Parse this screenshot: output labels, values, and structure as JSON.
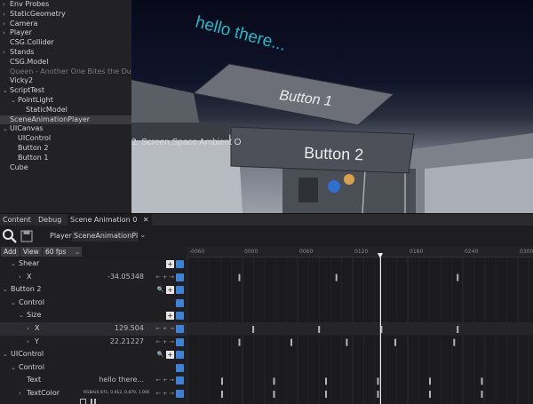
{
  "tree": [
    {
      "label": "Env Probes",
      "chev": "›",
      "indent": 0
    },
    {
      "label": "StaticGeometry",
      "chev": "›",
      "indent": 0
    },
    {
      "label": "Camera",
      "chev": "›",
      "indent": 0
    },
    {
      "label": "Player",
      "chev": "›",
      "indent": 0
    },
    {
      "label": "CSG.Collider",
      "chev": "",
      "indent": 0
    },
    {
      "label": "Stands",
      "chev": "›",
      "indent": 0
    },
    {
      "label": "CSG.Model",
      "chev": "",
      "indent": 0
    },
    {
      "label": "Queen - Another One Bites the Dust",
      "chev": "",
      "indent": 0,
      "dim": true
    },
    {
      "label": "Vicky2",
      "chev": "",
      "indent": 0
    },
    {
      "label": "ScriptTest",
      "chev": "⌄",
      "indent": 0
    },
    {
      "label": "PointLight",
      "chev": "⌄",
      "indent": 1
    },
    {
      "label": "StaticModel",
      "chev": "",
      "indent": 2
    },
    {
      "label": "SceneAnimationPlayer",
      "chev": "",
      "indent": 0,
      "selected": true
    },
    {
      "label": "UICanvas",
      "chev": "⌄",
      "indent": 0
    },
    {
      "label": "UIControl",
      "chev": "",
      "indent": 1
    },
    {
      "label": "Button 2",
      "chev": "",
      "indent": 1
    },
    {
      "label": "Button 1",
      "chev": "",
      "indent": 1
    },
    {
      "label": "Cube",
      "chev": "",
      "indent": 0
    }
  ],
  "viewport": {
    "hello_text": "hello there...",
    "button1_label": "Button 1",
    "button2_label": "Button 2",
    "wall_sign": "2. Screen Space Ambient O"
  },
  "tabs": {
    "content": "Content",
    "debug": "Debug",
    "scene_animation": "Scene Animation 0",
    "close": "✕"
  },
  "toolbar": {
    "player_label": "Player:",
    "player_value": "SceneAnimationPla",
    "add_label": "Add",
    "view_label": "View",
    "fps_value": "60 fps"
  },
  "tracks": [
    {
      "label": "Shear",
      "chev": "⌄",
      "indent": 1,
      "value": "",
      "plus": true
    },
    {
      "label": "X",
      "chev": "›",
      "indent": 2,
      "value": "-34.05348",
      "arrows": true
    },
    {
      "label": "Button 2",
      "chev": "⌄",
      "indent": 0,
      "value": "",
      "plus": true,
      "search": true
    },
    {
      "label": "Control",
      "chev": "⌄",
      "indent": 1,
      "value": "",
      "plus": false
    },
    {
      "label": "Size",
      "chev": "⌄",
      "indent": 2,
      "value": "",
      "plus": true
    },
    {
      "label": "X",
      "chev": "›",
      "indent": 3,
      "value": "129.504",
      "arrows": true,
      "highlight": true
    },
    {
      "label": "Y",
      "chev": "›",
      "indent": 3,
      "value": "22.21227",
      "arrows": true
    },
    {
      "label": "UIControl",
      "chev": "⌄",
      "indent": 0,
      "value": "",
      "plus": true,
      "search": true
    },
    {
      "label": "Control",
      "chev": "⌄",
      "indent": 1,
      "value": "",
      "plus": false
    },
    {
      "label": "Text",
      "chev": "",
      "indent": 2,
      "value": "hello there...",
      "arrows": true
    },
    {
      "label": "TextColor",
      "chev": "›",
      "indent": 2,
      "value": "RGBA(0.971, 0.912, 0.870, 1.000)",
      "arrows": true,
      "tiny": true
    }
  ],
  "ruler_ticks": [
    "-0060",
    "0000",
    "0060",
    "0120",
    "0180",
    "0240",
    "0300"
  ],
  "keyframe_rows": [
    [],
    [
      0.15,
      0.43,
      0.78
    ],
    [],
    [],
    [],
    [
      0.19,
      0.38,
      0.56,
      0.78
    ],
    [
      0.15,
      0.3,
      0.46,
      0.6,
      0.77
    ],
    [],
    [],
    [
      0.1,
      0.25,
      0.4,
      0.55,
      0.7,
      0.85
    ],
    [
      0.1,
      0.25,
      0.4,
      0.55,
      0.7,
      0.85
    ]
  ],
  "playhead_position": 0.56,
  "colors": {
    "accent": "#3b82d8",
    "hello_text": "#1fb9c4",
    "keyframe": "#b5b5b5",
    "panel": "#1f1f21"
  }
}
